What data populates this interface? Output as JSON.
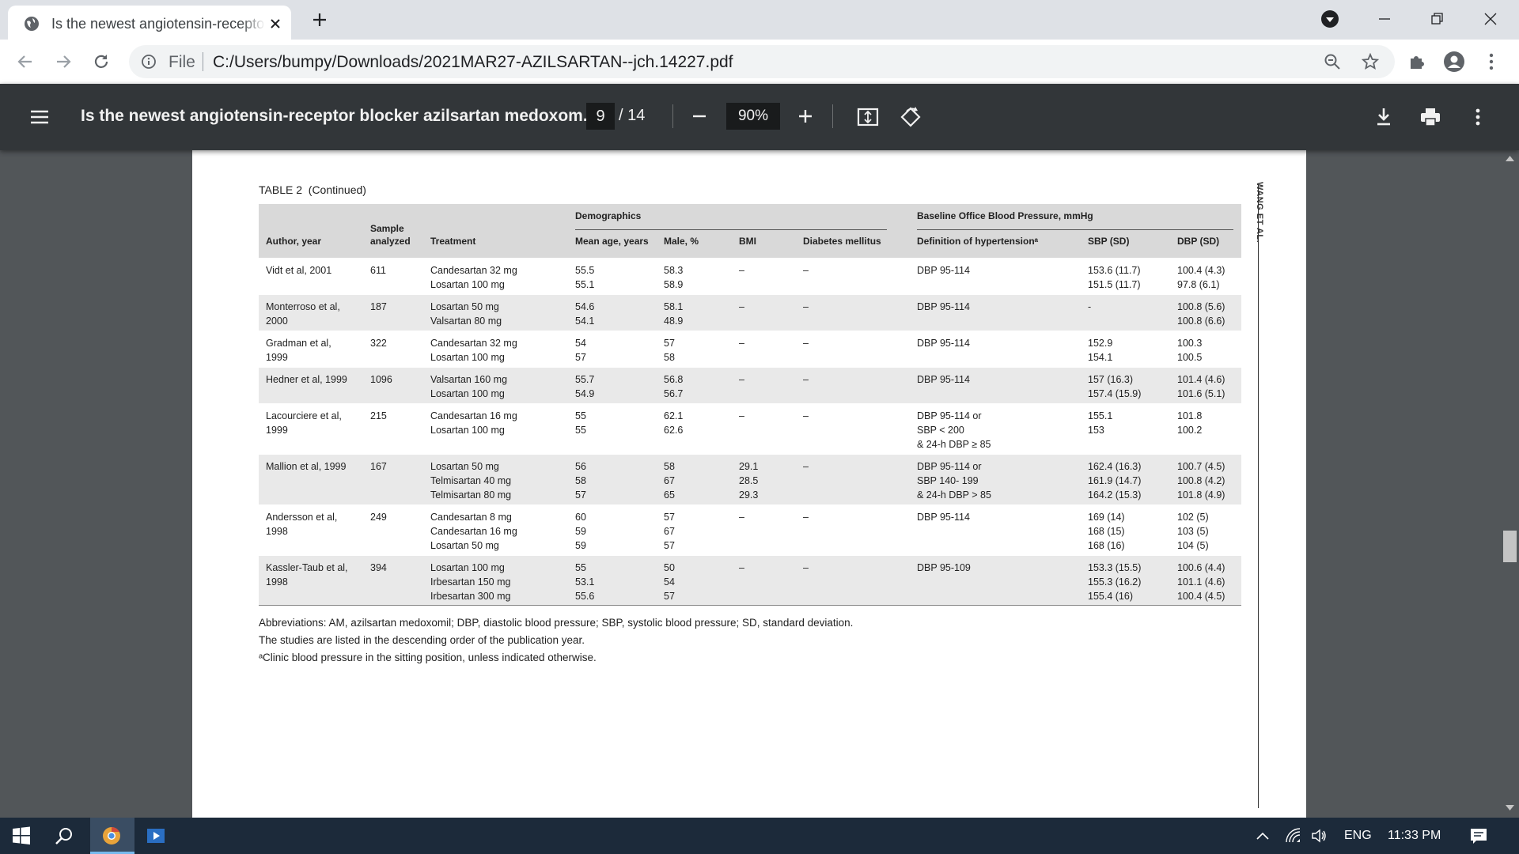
{
  "browser": {
    "tab_title": "Is the newest angiotensin-receptor blocker azilsartan medoxomil",
    "file_label": "File",
    "url": "C:/Users/bumpy/Downloads/2021MAR27-AZILSARTAN--jch.14227.pdf"
  },
  "pdf_toolbar": {
    "title": "Is the newest angiotensin-receptor blocker azilsartan medoxom...",
    "page_current": "9",
    "page_total": "/ 14",
    "zoom": "90%"
  },
  "page": {
    "running_head": "WANG ET AL.",
    "table_caption": "TABLE 2",
    "table_caption_suffix": "(Continued)",
    "group_headers": {
      "demographics": "Demographics",
      "baseline": "Baseline Office Blood Pressure, mmHg"
    },
    "columns": {
      "author": "Author, year",
      "sample_line1": "Sample",
      "sample_line2": "analyzed",
      "treatment": "Treatment",
      "age": "Mean age, years",
      "male": "Male, %",
      "bmi": "BMI",
      "diabetes": "Diabetes mellitus",
      "definition": "Definition of hypertensionᵃ",
      "sbp": "SBP (SD)",
      "dbp": "DBP (SD)"
    },
    "rows": [
      {
        "author": "Vidt et al, 2001",
        "sample": "611",
        "treatment": "Candesartan 32 mg\nLosartan 100 mg",
        "age": "55.5\n55.1",
        "male": "58.3\n58.9",
        "bmi": "–",
        "diabetes": "–",
        "definition": "DBP 95-114",
        "sbp": "153.6 (11.7)\n151.5 (11.7)",
        "dbp": "100.4 (4.3)\n97.8 (6.1)"
      },
      {
        "author": "Monterroso et al,\n    2000",
        "sample": "187",
        "treatment": "Losartan 50 mg\nValsartan 80 mg",
        "age": "54.6\n54.1",
        "male": "58.1\n48.9",
        "bmi": "–",
        "diabetes": "–",
        "definition": "DBP 95-114",
        "sbp": "-",
        "dbp": "100.8 (5.6)\n100.8 (6.6)"
      },
      {
        "author": "Gradman et al,\n    1999",
        "sample": "322",
        "treatment": "Candesartan 32 mg\nLosartan 100 mg",
        "age": "54\n57",
        "male": "57\n58",
        "bmi": "–",
        "diabetes": "–",
        "definition": "DBP 95-114",
        "sbp": "152.9\n154.1",
        "dbp": "100.3\n100.5"
      },
      {
        "author": "Hedner et al, 1999",
        "sample": "1096",
        "treatment": "Valsartan 160 mg\nLosartan 100 mg",
        "age": "55.7\n54.9",
        "male": "56.8\n56.7",
        "bmi": "–",
        "diabetes": "–",
        "definition": "DBP 95-114",
        "sbp": "157 (16.3)\n157.4 (15.9)",
        "dbp": "101.4 (4.6)\n101.6 (5.1)"
      },
      {
        "author": "Lacourciere et al,\n    1999",
        "sample": "215",
        "treatment": "Candesartan 16 mg\nLosartan 100 mg",
        "age": "55\n55",
        "male": "62.1\n62.6",
        "bmi": "–",
        "diabetes": "–",
        "definition": "DBP 95-114 or\nSBP < 200\n& 24-h DBP ≥ 85",
        "sbp": "155.1\n153",
        "dbp": "101.8\n100.2"
      },
      {
        "author": "Mallion et al, 1999",
        "sample": "167",
        "treatment": "Losartan 50 mg\nTelmisartan 40 mg\nTelmisartan 80 mg",
        "age": "56\n58\n57",
        "male": "58\n67\n65",
        "bmi": "29.1\n28.5\n29.3",
        "diabetes": "–",
        "definition": "DBP 95-114 or\nSBP 140- 199\n& 24-h DBP > 85",
        "sbp": "162.4 (16.3)\n161.9 (14.7)\n164.2 (15.3)",
        "dbp": "100.7 (4.5)\n100.8 (4.2)\n101.8 (4.9)"
      },
      {
        "author": "Andersson et al,\n    1998",
        "sample": "249",
        "treatment": "Candesartan 8 mg\nCandesartan 16 mg\nLosartan 50 mg",
        "age": "60\n59\n59",
        "male": "57\n67\n57",
        "bmi": "–",
        "diabetes": "–",
        "definition": "DBP 95-114",
        "sbp": "169 (14)\n168 (15)\n168 (16)",
        "dbp": "102 (5)\n103 (5)\n104 (5)"
      },
      {
        "author": "Kassler-Taub et al,\n    1998",
        "sample": "394",
        "treatment": "Losartan 100 mg\nIrbesartan 150 mg\nIrbesartan 300 mg",
        "age": "55\n53.1\n55.6",
        "male": "50\n54\n57",
        "bmi": "–",
        "diabetes": "–",
        "definition": "DBP 95-109",
        "sbp": "153.3 (15.5)\n155.3 (16.2)\n155.4 (16)",
        "dbp": "100.6 (4.4)\n101.1 (4.6)\n100.4 (4.5)"
      }
    ],
    "notes": [
      "Abbreviations: AM, azilsartan medoxomil; DBP, diastolic blood pressure; SBP, systolic blood pressure; SD, standard deviation.",
      "The studies are listed in the descending order of the publication year.",
      "ᵃClinic blood pressure in the sitting position, unless indicated otherwise."
    ]
  },
  "taskbar": {
    "language": "ENG",
    "time": "11:33 PM"
  },
  "icons": [
    "globe-icon",
    "close-icon",
    "plus-icon",
    "profile-dropdown-icon",
    "minimize-icon",
    "restore-icon",
    "window-close-icon",
    "back-arrow-icon",
    "forward-arrow-icon",
    "reload-icon",
    "info-icon",
    "zoom-out-magnifier-icon",
    "star-icon",
    "extensions-puzzle-icon",
    "account-icon",
    "kebab-menu-icon",
    "hamburger-menu-icon",
    "zoom-minus-icon",
    "zoom-plus-icon",
    "fit-page-icon",
    "rotate-icon",
    "download-icon",
    "print-icon",
    "windows-start-icon",
    "search-icon",
    "chrome-icon",
    "media-player-icon",
    "chevron-up-icon",
    "wifi-icon",
    "volume-icon",
    "notification-icon"
  ]
}
